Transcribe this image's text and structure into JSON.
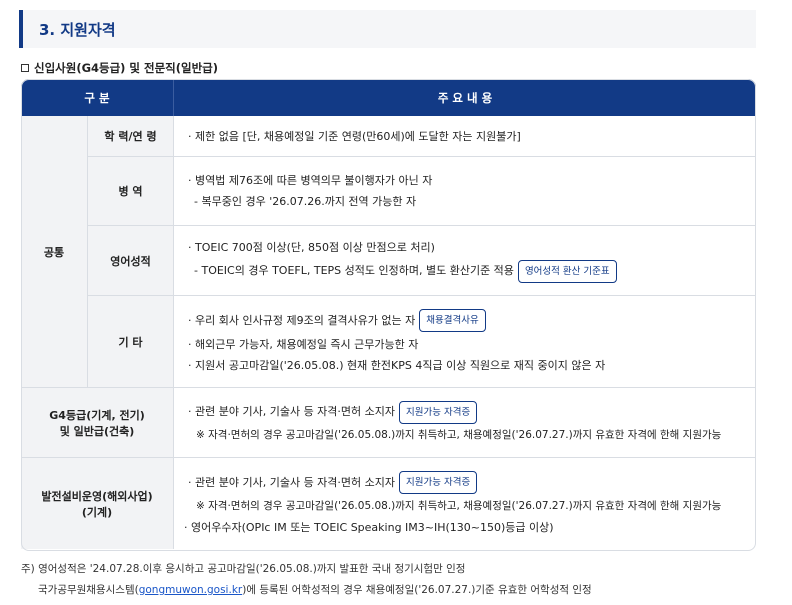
{
  "section": {
    "title": "3. 지원자격"
  },
  "subtitle": "신입사원(G4등급) 및 전문직(일반급)",
  "table": {
    "headers": [
      "구 분",
      "주 요 내 용"
    ],
    "common_label": "공통",
    "rows": {
      "education": {
        "label": "학 력/연 령",
        "lines": [
          "· 제한 없음 [단, 채용예정일 기준 연령(만60세)에 도달한 자는 지원불가]"
        ]
      },
      "military": {
        "label": "병 역",
        "lines": [
          "· 병역법 제76조에 따른 병역의무 불이행자가 아닌 자",
          "- 복무중인 경우 '26.07.26.까지 전역 가능한 자"
        ]
      },
      "english": {
        "label": "영어성적",
        "lines": [
          "· TOEIC 700점 이상(단, 850점 이상 만점으로 처리)",
          "- TOEIC의 경우 TOEFL, TEPS 성적도 인정하며, 별도 환산기준 적용"
        ],
        "button": "영어성적 환산 기준표"
      },
      "etc": {
        "label": "기 타",
        "lines": [
          "· 우리 회사 인사규정 제9조의 결격사유가 없는 자",
          "· 해외근무 가능자, 채용예정일 즉시 근무가능한 자",
          "· 지원서 공고마감일('26.05.08.) 현재 한전KPS 4직급 이상 직원으로 재직 중이지 않은 자"
        ],
        "button": "채용결격사유"
      },
      "g4": {
        "label_line1": "G4등급(기계, 전기)",
        "label_line2": "및 일반급(건축)",
        "lines": [
          "· 관련 분야 기사, 기술사 등 자격·면허 소지자",
          "※ 자격·면허의 경우 공고마감일('26.05.08.)까지 취득하고, 채용예정일('26.07.27.)까지 유효한 자격에 한해 지원가능"
        ],
        "button": "지원가능 자격증"
      },
      "power": {
        "label_line1": "발전설비운영(해외사업)",
        "label_line2": "(기계)",
        "lines": [
          "· 관련 분야 기사, 기술사 등 자격·면허 소지자",
          "※ 자격·면허의 경우 공고마감일('26.05.08.)까지 취득하고, 채용예정일('26.07.27.)까지 유효한 자격에 한해 지원가능",
          "· 영어우수자(OPIc IM 또는 TOEIC Speaking IM3~IH(130~150)등급 이상)"
        ],
        "button": "지원가능 자격증"
      }
    }
  },
  "notes": {
    "line1": "주) 영어성적은 '24.07.28.이후 응시하고 공고마감일('26.05.08.)까지 발표한 국내 정기시험만 인정",
    "line2_pre": "국가공무원채용시스템(",
    "line2_link": "gongmuwon.gosi.kr",
    "line2_post": ")에 등록된 어학성적의 경우 채용예정일('26.07.27.)기준 유효한 어학성적 인정"
  }
}
